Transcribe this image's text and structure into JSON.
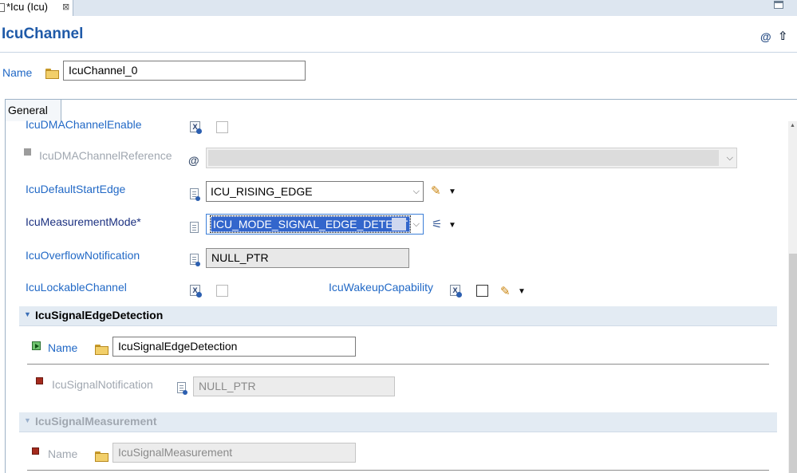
{
  "tab": {
    "title": "*Icu (Icu)",
    "close_glyph": "⊠"
  },
  "header": {
    "title": "IcuChannel",
    "at_icon": "@",
    "up_icon": "⇧"
  },
  "name_row": {
    "label": "Name",
    "value": "IcuChannel_0"
  },
  "form": {
    "tab_label": "General",
    "dma_enable": {
      "label": "IcuDMAChannelEnable"
    },
    "dma_reference": {
      "label": "IcuDMAChannelReference"
    },
    "default_start_edge": {
      "label": "IcuDefaultStartEdge",
      "value": "ICU_RISING_EDGE"
    },
    "measurement_mode": {
      "label": "IcuMeasurementMode*",
      "value": "ICU_MODE_SIGNAL_EDGE_DETECT"
    },
    "overflow_notification": {
      "label": "IcuOverflowNotification",
      "value": "NULL_PTR"
    },
    "lockable_channel": {
      "label": "IcuLockableChannel"
    },
    "wakeup_capability": {
      "label": "IcuWakeupCapability"
    }
  },
  "edge_detection": {
    "title": "IcuSignalEdgeDetection",
    "name_label": "Name",
    "name_value": "IcuSignalEdgeDetection",
    "notification_label": "IcuSignalNotification",
    "notification_value": "NULL_PTR"
  },
  "signal_measurement": {
    "title": "IcuSignalMeasurement",
    "name_label": "Name",
    "name_value": "IcuSignalMeasurement"
  },
  "glyphs": {
    "chevron": "⌵",
    "pencil": "✎",
    "wand": "⚟",
    "dropdown": "▼",
    "collapse": "▼",
    "xdoc": "X"
  },
  "colors": {
    "link": "#2269c6",
    "title": "#1f5aa8",
    "selection": "#3366cc",
    "section_bar": "#e3ebf3"
  }
}
